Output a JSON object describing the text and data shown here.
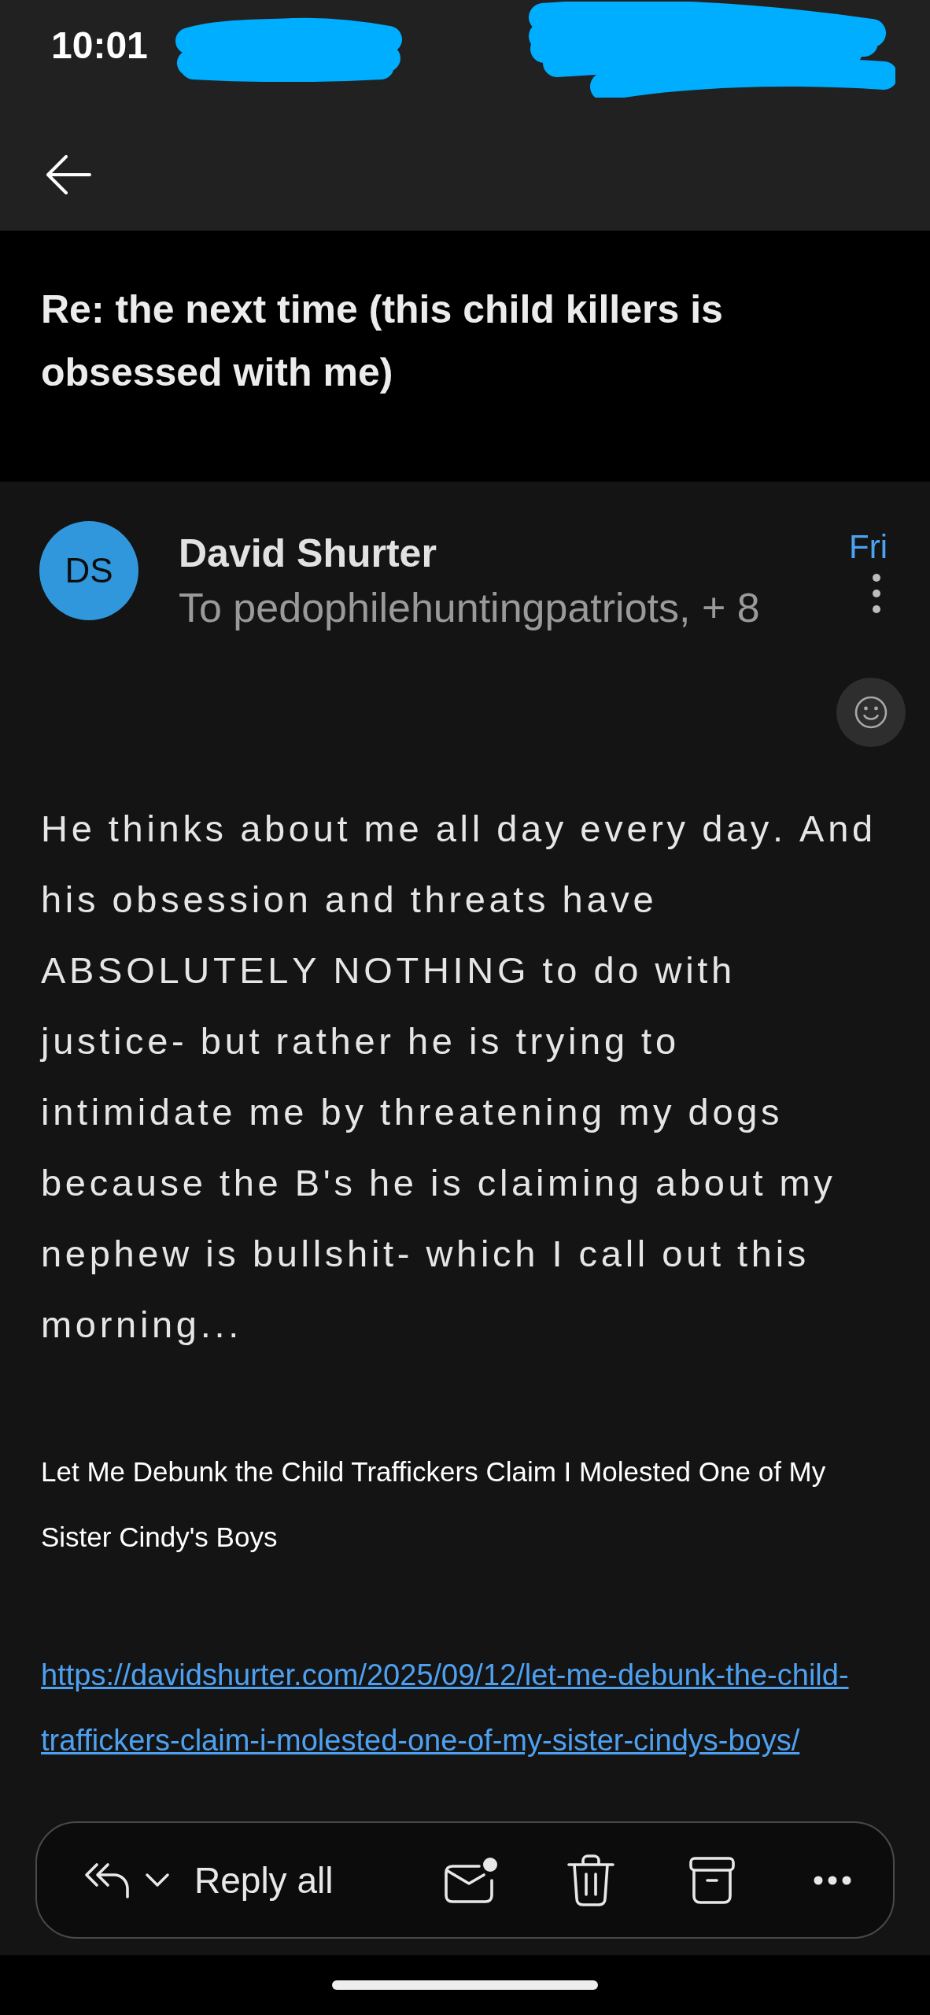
{
  "status_bar": {
    "time": "10:01"
  },
  "subject": "Re: the next time (this child killers is obsessed with me)",
  "message": {
    "avatar_initials": "DS",
    "sender": "David Shurter",
    "recipients": "To pedophilehuntingpatriots, + 8",
    "date": "Fri",
    "body": "He thinks about me all day every day. And his obsession and threats have ABSOLUTELY NOTHING to do with justice- but rather he is trying to intimidate me by threatening my dogs because the B's he is claiming about my nephew is bullshit- which I call out this morning...",
    "article_title": "Let Me Debunk the Child Traffickers Claim I Molested One of My Sister Cindy's Boys",
    "link": "https://davidshurter.com/2025/09/12/let-me-debunk-the-child-traffickers-claim-i-molested-one-of-my-sister-cindys-boys/"
  },
  "action_bar": {
    "reply_label": "Reply all"
  }
}
